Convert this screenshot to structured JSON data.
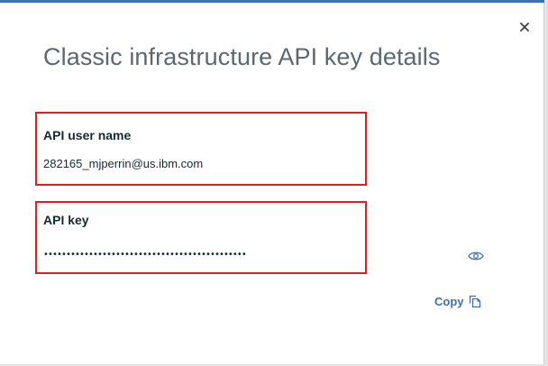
{
  "dialog": {
    "title": "Classic infrastructure API key details",
    "close_icon": "close-icon"
  },
  "user_field": {
    "label": "API user name",
    "value": "282165_mjperrin@us.ibm.com"
  },
  "key_field": {
    "label": "API key",
    "masked_value": "•••••••••••••••••••••••••••••••••••••••••••••",
    "visibility_icon": "eye-icon"
  },
  "copy_button": {
    "label": "Copy",
    "icon": "copy-icon"
  },
  "colors": {
    "accent": "#3d70b2",
    "highlight_border": "#e02020",
    "text_primary": "#152935",
    "text_title": "#5a6872"
  }
}
